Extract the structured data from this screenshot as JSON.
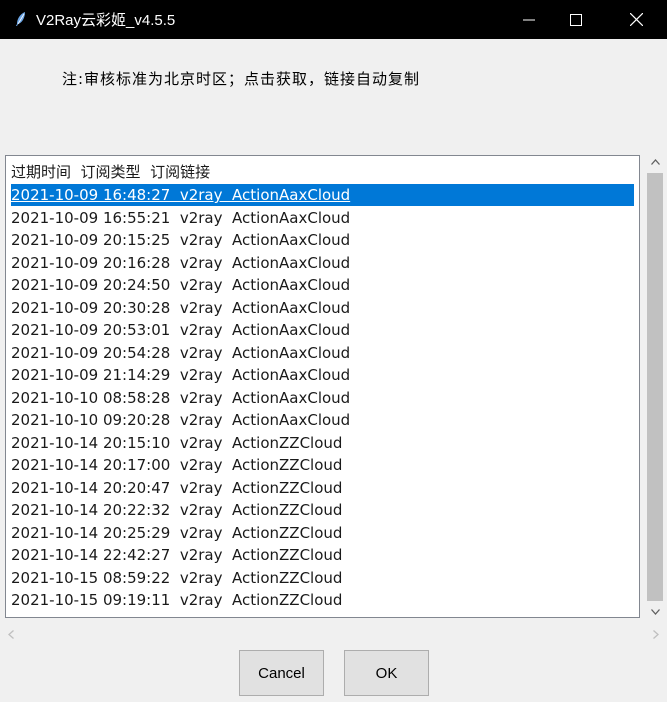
{
  "window": {
    "title": "V2Ray云彩姬_v4.5.5"
  },
  "note": "注:审核标准为北京时区；点击获取，链接自动复制",
  "list": {
    "header": "过期时间  订阅类型  订阅链接",
    "selected_index": 0,
    "rows": [
      "2021-10-09 16:48:27  v2ray  ActionAaxCloud",
      "2021-10-09 16:55:21  v2ray  ActionAaxCloud",
      "2021-10-09 20:15:25  v2ray  ActionAaxCloud",
      "2021-10-09 20:16:28  v2ray  ActionAaxCloud",
      "2021-10-09 20:24:50  v2ray  ActionAaxCloud",
      "2021-10-09 20:30:28  v2ray  ActionAaxCloud",
      "2021-10-09 20:53:01  v2ray  ActionAaxCloud",
      "2021-10-09 20:54:28  v2ray  ActionAaxCloud",
      "2021-10-09 21:14:29  v2ray  ActionAaxCloud",
      "2021-10-10 08:58:28  v2ray  ActionAaxCloud",
      "2021-10-10 09:20:28  v2ray  ActionAaxCloud",
      "2021-10-14 20:15:10  v2ray  ActionZZCloud",
      "2021-10-14 20:17:00  v2ray  ActionZZCloud",
      "2021-10-14 20:20:47  v2ray  ActionZZCloud",
      "2021-10-14 20:22:32  v2ray  ActionZZCloud",
      "2021-10-14 20:25:29  v2ray  ActionZZCloud",
      "2021-10-14 22:42:27  v2ray  ActionZZCloud",
      "2021-10-15 08:59:22  v2ray  ActionZZCloud",
      "2021-10-15 09:19:11  v2ray  ActionZZCloud"
    ]
  },
  "buttons": {
    "cancel": "Cancel",
    "ok": "OK"
  },
  "colors": {
    "selection": "#0078d7",
    "titlebar": "#000000"
  }
}
